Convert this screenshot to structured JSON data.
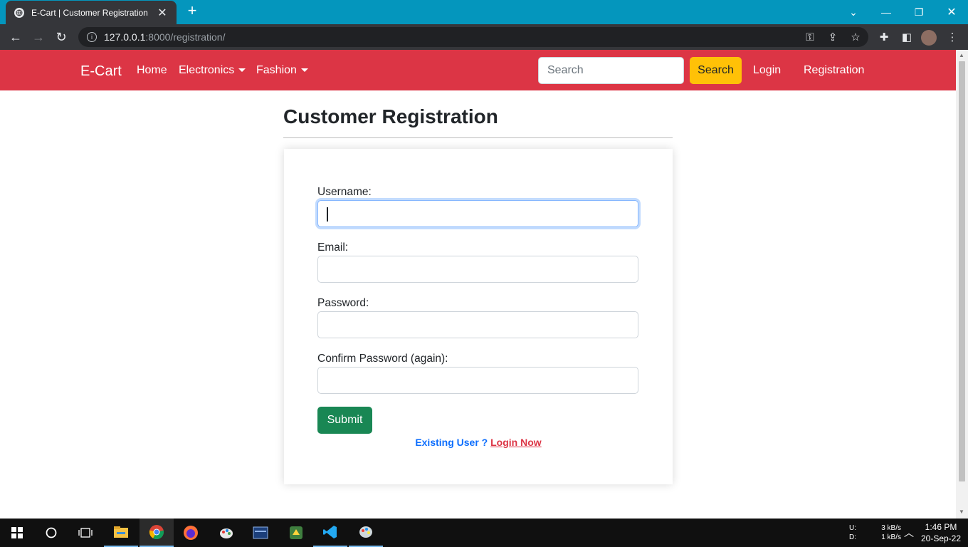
{
  "browser": {
    "tab_title": "E-Cart | Customer Registration",
    "new_tab": "+",
    "url_host": "127.0.0.1",
    "url_rest": ":8000/registration/"
  },
  "navbar": {
    "brand": "E-Cart",
    "home": "Home",
    "electronics": "Electronics",
    "fashion": "Fashion",
    "search_placeholder": "Search",
    "search_button": "Search",
    "login": "Login",
    "registration": "Registration",
    "colors": {
      "background": "#dc3545",
      "search_button": "#ffc107"
    }
  },
  "page": {
    "heading": "Customer Registration",
    "form": {
      "username_label": "Username:",
      "username_value": "",
      "email_label": "Email:",
      "email_value": "",
      "password_label": "Password:",
      "password_value": "",
      "confirm_label": "Confirm Password (again):",
      "confirm_value": "",
      "submit": "Submit"
    },
    "existing_user": "Existing User ?",
    "login_now": "Login Now",
    "colors": {
      "submit": "#198754",
      "existing_user": "#0d6efd",
      "login_now": "#dc3545"
    }
  },
  "taskbar": {
    "net_up_label": "U:",
    "net_down_label": "D:",
    "net_up": "3 kB/s",
    "net_down": "1 kB/s",
    "time": "1:46 PM",
    "date": "20-Sep-22"
  }
}
